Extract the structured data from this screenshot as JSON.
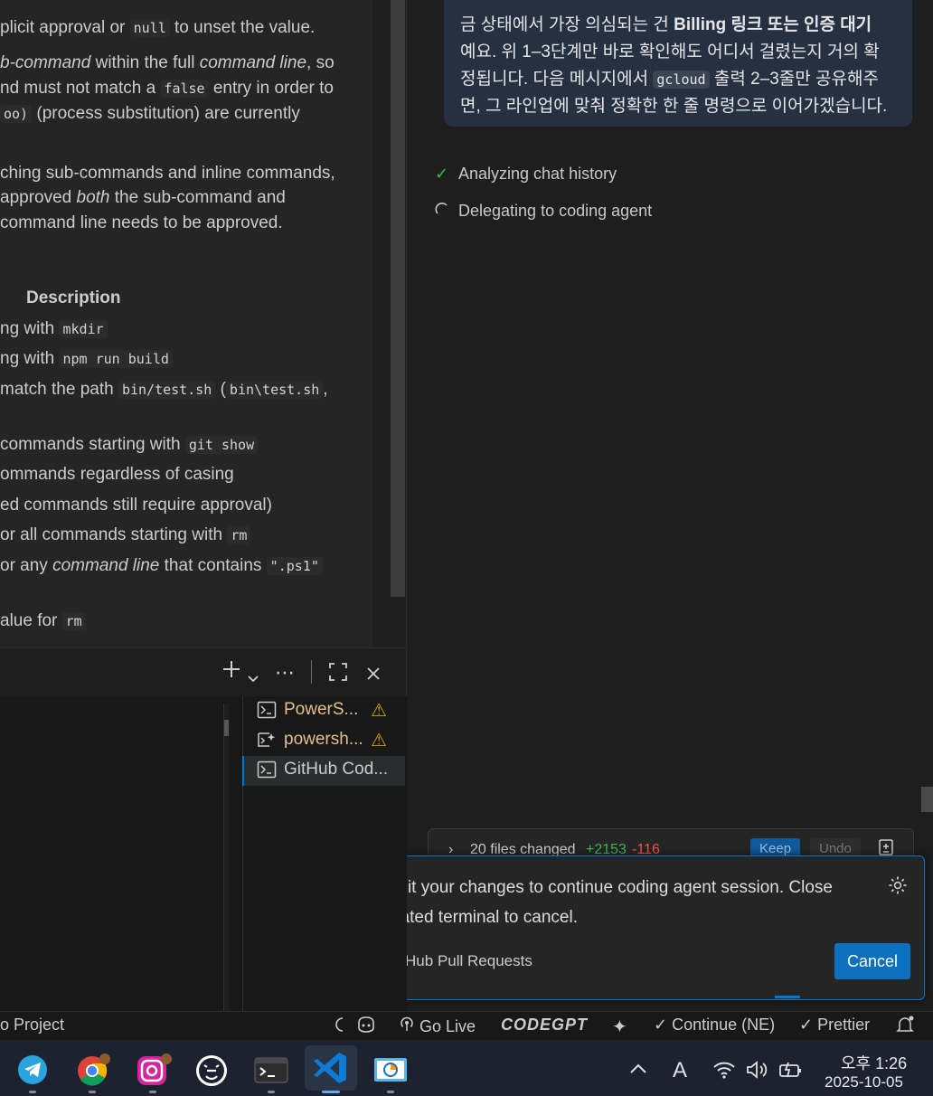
{
  "doc": {
    "line1": {
      "pre": "plicit approval or ",
      "code": "null",
      "post": " to unset the value."
    },
    "line2": {
      "italic1": "b-command",
      "mid": " within the full ",
      "italic2": "command line",
      "post": ", so"
    },
    "line3": {
      "pre": "nd must not match a ",
      "code": "false",
      "post": " entry in order to"
    },
    "line4": {
      "code": "oo)",
      "post": " (process substitution) are currently"
    },
    "line5": "ching sub-commands and inline commands,",
    "line6": {
      "pre": " approved ",
      "italic": "both",
      "post": " the sub-command and"
    },
    "line7": " command line needs to be approved.",
    "desc_header": "Description",
    "rows": [
      {
        "pre": "ng with ",
        "code": "mkdir",
        "post": ""
      },
      {
        "pre": "ng with ",
        "code": "npm run build",
        "post": ""
      },
      {
        "pre": "match the path ",
        "code": "bin/test.sh",
        "post": " (",
        "code2": "bin\\test.sh",
        "post2": ","
      },
      {
        "pre": "commands starting with ",
        "code": "git show",
        "post": ""
      },
      {
        "pre": "ommands regardless of casing",
        "code": "",
        "post": ""
      },
      {
        "pre": "ed commands still require approval)",
        "code": "",
        "post": ""
      },
      {
        "pre": "or all commands starting with ",
        "code": "rm",
        "post": ""
      },
      {
        "pre": "or any ",
        "italic": "command line",
        "mid": " that contains ",
        "code": "\".ps1\"",
        "post": ""
      },
      {
        "pre": "alue for ",
        "code": "rm",
        "post": ""
      }
    ]
  },
  "chat": {
    "bubble_lines": [
      {
        "text": "금 상태에서 가장 의심되는 건 ",
        "bold": "Billing 링크 또는 인증 대기"
      },
      {
        "text": "예요. 위 1–3단계만 바로 확인해도 어디서 걸렸는지 거의 확"
      },
      {
        "text": "정됩니다. 다음 메시지에서 ",
        "code": "gcloud",
        "post": " 출력 2–3줄만 공유해주"
      },
      {
        "text": "면, 그 라인업에 맞춰 정확한 한 줄 명령으로 이어가겠습니다."
      }
    ],
    "steps": [
      {
        "label": "Analyzing chat history",
        "state": "done"
      },
      {
        "label": "Delegating to coding agent",
        "state": "running"
      }
    ],
    "files_changed": {
      "label": "20 files changed",
      "added": "+2153",
      "removed": "-116",
      "keep": "Keep",
      "undo": "Undo"
    }
  },
  "notification": {
    "message": "Commit your changes to continue coding agent session. Close integrated terminal to cancel.",
    "source": "Source: GitHub Pull Requests",
    "cancel": "Cancel"
  },
  "terminals": [
    {
      "label": "PowerS...",
      "icon": "terminal-icon",
      "warning": true,
      "color": "#e2c08d"
    },
    {
      "label": "powersh...",
      "icon": "sparkle-terminal-icon",
      "warning": true,
      "color": "#e2c08d"
    },
    {
      "label": "GitHub Cod...",
      "icon": "terminal-icon",
      "warning": false,
      "color": "#cccccc",
      "active": true
    }
  ],
  "statusbar": {
    "project": "o Project",
    "golive": "Go Live",
    "codegpt": "CODEGPT",
    "continue": "Continue (NE)",
    "prettier": "Prettier"
  },
  "taskbar": {
    "time": "오후 1:26",
    "date": "2025-10-05",
    "ime": "A"
  },
  "colors": {
    "accent": "#0078d4",
    "added": "#3fb950",
    "removed": "#f85149",
    "warning": "#cca700"
  }
}
